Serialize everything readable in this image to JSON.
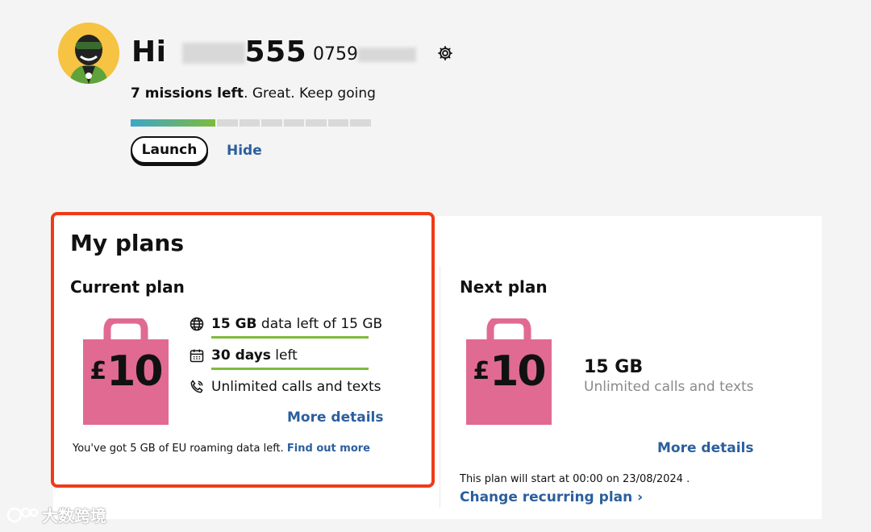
{
  "header": {
    "greeting_prefix": "Hi",
    "username_visible": "555",
    "phone_visible": "0759",
    "settings_icon": "gear-icon"
  },
  "missions": {
    "bold": "7 missions left",
    "rest": ". Great. Keep going",
    "progress_fraction": 0.35,
    "launch_label": "Launch",
    "hide_label": "Hide"
  },
  "plans": {
    "title": "My plans",
    "current": {
      "title": "Current plan",
      "price_symbol": "£",
      "price_value": "10",
      "data_bold": "15 GB",
      "data_rest": " data left of 15 GB",
      "days_bold": "30 days",
      "days_rest": " left",
      "calls": "Unlimited calls and texts",
      "more_details": "More details",
      "roaming_text": "You've got 5 GB of EU roaming data left.",
      "roaming_link": "Find out more"
    },
    "next": {
      "title": "Next plan",
      "price_symbol": "£",
      "price_value": "10",
      "data": "15 GB",
      "calls": "Unlimited calls and texts",
      "more_details": "More details",
      "start_text": "This plan will start at 00:00 on 23/08/2024 .",
      "change_link": "Change recurring plan ›"
    }
  },
  "colors": {
    "accent_link": "#2b5f9e",
    "bag_pink": "#e06a92",
    "highlight_red": "#f03a17",
    "progress_green": "#7dbb3b"
  },
  "watermark": "大数跨境"
}
